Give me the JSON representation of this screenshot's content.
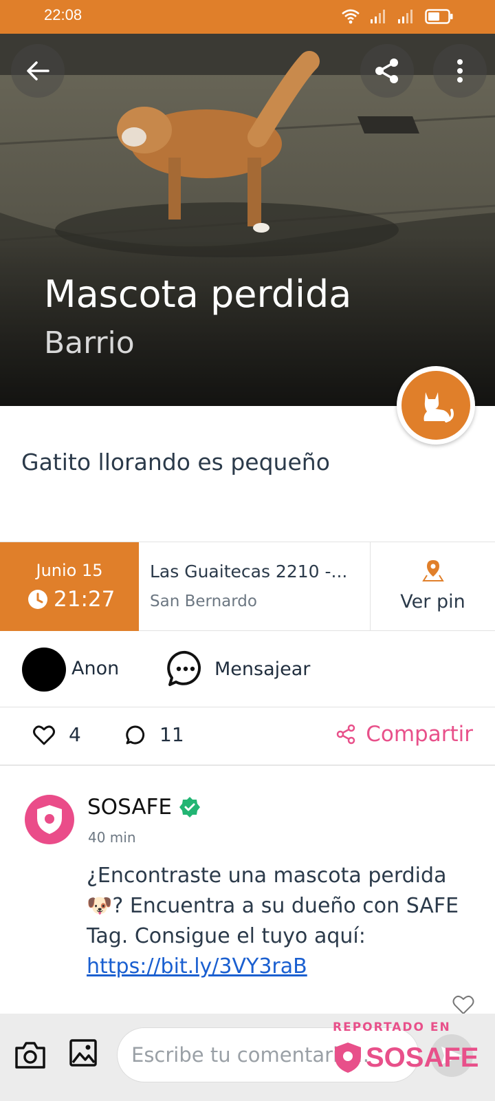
{
  "status_bar": {
    "time": "22:08"
  },
  "hero": {
    "title": "Mascota perdida",
    "subtitle": "Barrio"
  },
  "report": {
    "description": "Gatito llorando es pequeño",
    "date": "Junio 15",
    "time": "21:27",
    "address_line1": "Las Guaitecas  2210 -...",
    "address_line2": "San Bernardo",
    "pin_label": "Ver pin"
  },
  "user": {
    "name": "Anon",
    "message_label": "Mensajear"
  },
  "actions": {
    "likes": "4",
    "comments": "11",
    "share_label": "Compartir"
  },
  "comment": {
    "author": "SOSAFE",
    "time": "40 min",
    "text_before_emoji": "¿Encontraste una mascota perdida ",
    "emoji": "🐶",
    "text_after_emoji": "? Encuentra a su dueño con SAFE Tag. Consigue el tuyo aquí: ",
    "link": "https://bit.ly/3VY3raB"
  },
  "composer": {
    "placeholder": "Escribe tu comentario..."
  },
  "watermark": {
    "top": "REPORTADO EN",
    "brand": "SOSAFE"
  },
  "colors": {
    "accent": "#e07f2a",
    "pink": "#e8508a",
    "verified": "#22b573",
    "link": "#1a5fd0"
  }
}
